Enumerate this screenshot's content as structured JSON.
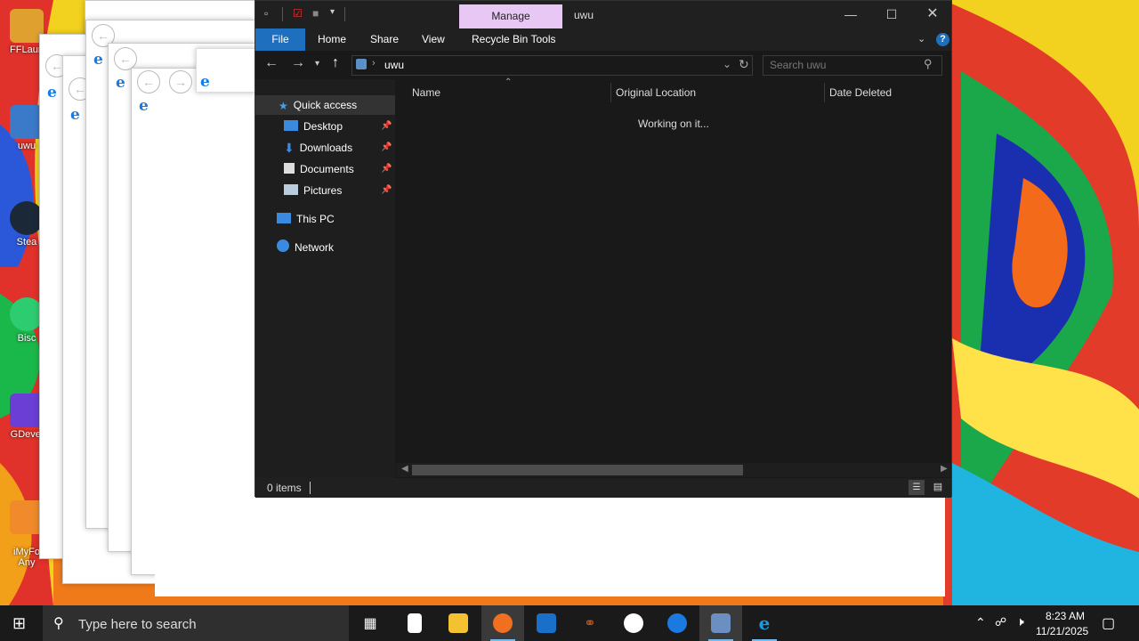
{
  "desktop": {
    "icons": [
      {
        "label": "FFLaun",
        "icon": "ffl-icon",
        "color": "#e0a030"
      },
      {
        "label": "uwu",
        "icon": "recycle-bin-icon",
        "color": "#3a7ac8"
      },
      {
        "label": "Stea",
        "icon": "steam-icon",
        "color": "#1b2838"
      },
      {
        "label": "Bisc",
        "icon": "biscuit-icon",
        "color": "#2ecc71"
      },
      {
        "label": "GDevel",
        "icon": "gdevelop-icon",
        "color": "#6b3fd6"
      },
      {
        "label": "iMyFo\nAny",
        "icon": "imyfone-icon",
        "color": "#f08a2a"
      }
    ]
  },
  "explorer": {
    "manage_tab": "Manage",
    "window_title": "uwu",
    "ribbon_tabs": [
      "File",
      "Home",
      "Share",
      "View",
      "Recycle Bin Tools"
    ],
    "address": {
      "path_icon": "recycle-bin-icon",
      "path": "uwu"
    },
    "search": {
      "placeholder": "Search uwu"
    },
    "nav": {
      "quick_access": "Quick access",
      "items": [
        {
          "label": "Desktop",
          "icon": "desktop-folder-icon",
          "pinned": true
        },
        {
          "label": "Downloads",
          "icon": "downloads-folder-icon",
          "pinned": true
        },
        {
          "label": "Documents",
          "icon": "documents-folder-icon",
          "pinned": true
        },
        {
          "label": "Pictures",
          "icon": "pictures-folder-icon",
          "pinned": true
        }
      ],
      "this_pc": "This PC",
      "network": "Network"
    },
    "columns": [
      "Name",
      "Original Location",
      "Date Deleted"
    ],
    "loading_text": "Working on it...",
    "status": "0 items"
  },
  "taskbar": {
    "search_placeholder": "Type here to search",
    "apps": [
      "task-view-icon",
      "notepad-icon",
      "file-explorer-icon",
      "firefox-icon",
      "outlook-icon",
      "bug-app-icon",
      "amazon-icon",
      "blue-app-icon",
      "recycle-manage-icon",
      "internet-explorer-icon"
    ],
    "time": "8:23 AM",
    "date": "11/21/2025"
  }
}
